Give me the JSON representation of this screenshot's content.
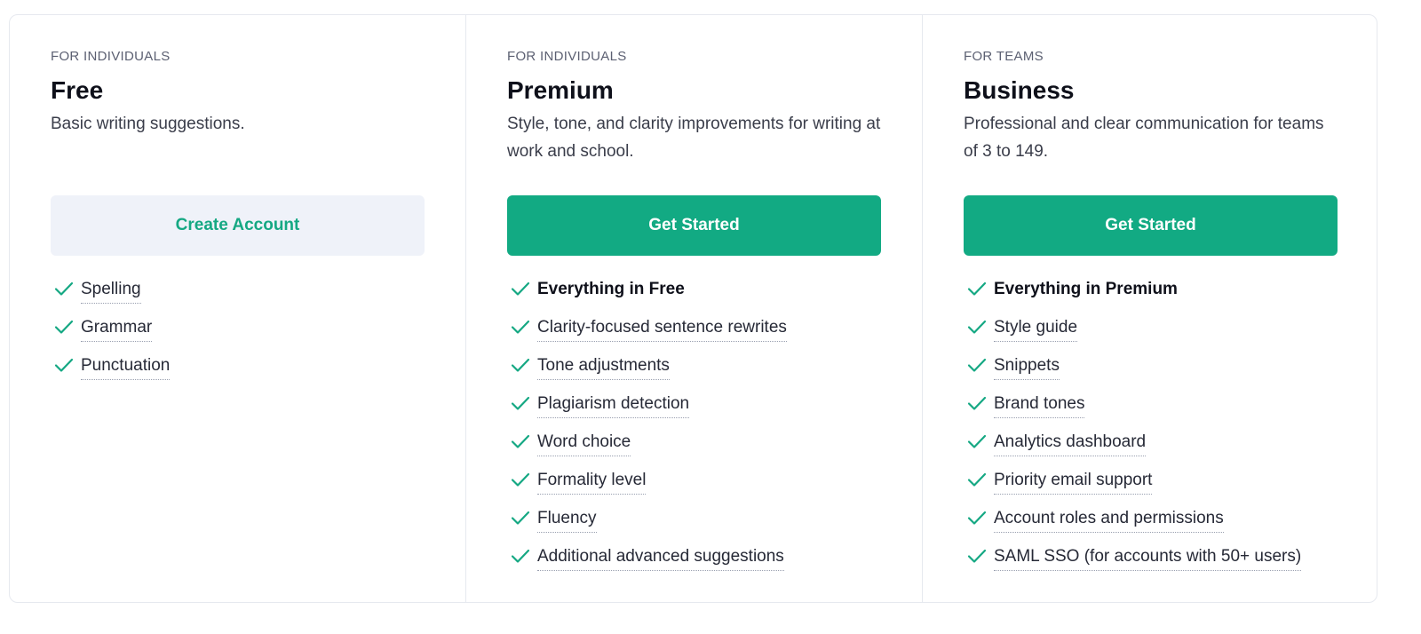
{
  "colors": {
    "accent": "#12aa83",
    "secondary_bg": "#eff2f9",
    "check": "#15a883",
    "border": "#e6e9ef"
  },
  "plans": [
    {
      "audience": "FOR INDIVIDUALS",
      "name": "Free",
      "description": "Basic writing suggestions.",
      "cta_label": "Create Account",
      "features": [
        {
          "label": "Spelling",
          "icon": "check-icon"
        },
        {
          "label": "Grammar",
          "icon": "check-icon"
        },
        {
          "label": "Punctuation",
          "icon": "check-icon"
        }
      ]
    },
    {
      "audience": "FOR INDIVIDUALS",
      "name": "Premium",
      "description": "Style, tone, and clarity improvements for writing at work and school.",
      "cta_label": "Get Started",
      "features": [
        {
          "label": "Everything in Free",
          "icon": "check-icon"
        },
        {
          "label": "Clarity-focused sentence rewrites",
          "icon": "check-icon"
        },
        {
          "label": "Tone adjustments",
          "icon": "check-icon"
        },
        {
          "label": "Plagiarism detection",
          "icon": "check-icon"
        },
        {
          "label": "Word choice",
          "icon": "check-icon"
        },
        {
          "label": "Formality level",
          "icon": "check-icon"
        },
        {
          "label": "Fluency",
          "icon": "check-icon"
        },
        {
          "label": "Additional advanced suggestions",
          "icon": "check-icon"
        }
      ]
    },
    {
      "audience": "FOR TEAMS",
      "name": "Business",
      "description": "Professional and clear communication for teams of 3 to 149.",
      "cta_label": "Get Started",
      "features": [
        {
          "label": "Everything in Premium",
          "icon": "check-icon"
        },
        {
          "label": "Style guide",
          "icon": "check-icon"
        },
        {
          "label": "Snippets",
          "icon": "check-icon"
        },
        {
          "label": "Brand tones",
          "icon": "check-icon"
        },
        {
          "label": "Analytics dashboard",
          "icon": "check-icon"
        },
        {
          "label": "Priority email support",
          "icon": "check-icon"
        },
        {
          "label": "Account roles and permissions",
          "icon": "check-icon"
        },
        {
          "label": "SAML SSO (for accounts with 50+ users)",
          "icon": "check-icon"
        }
      ]
    }
  ]
}
